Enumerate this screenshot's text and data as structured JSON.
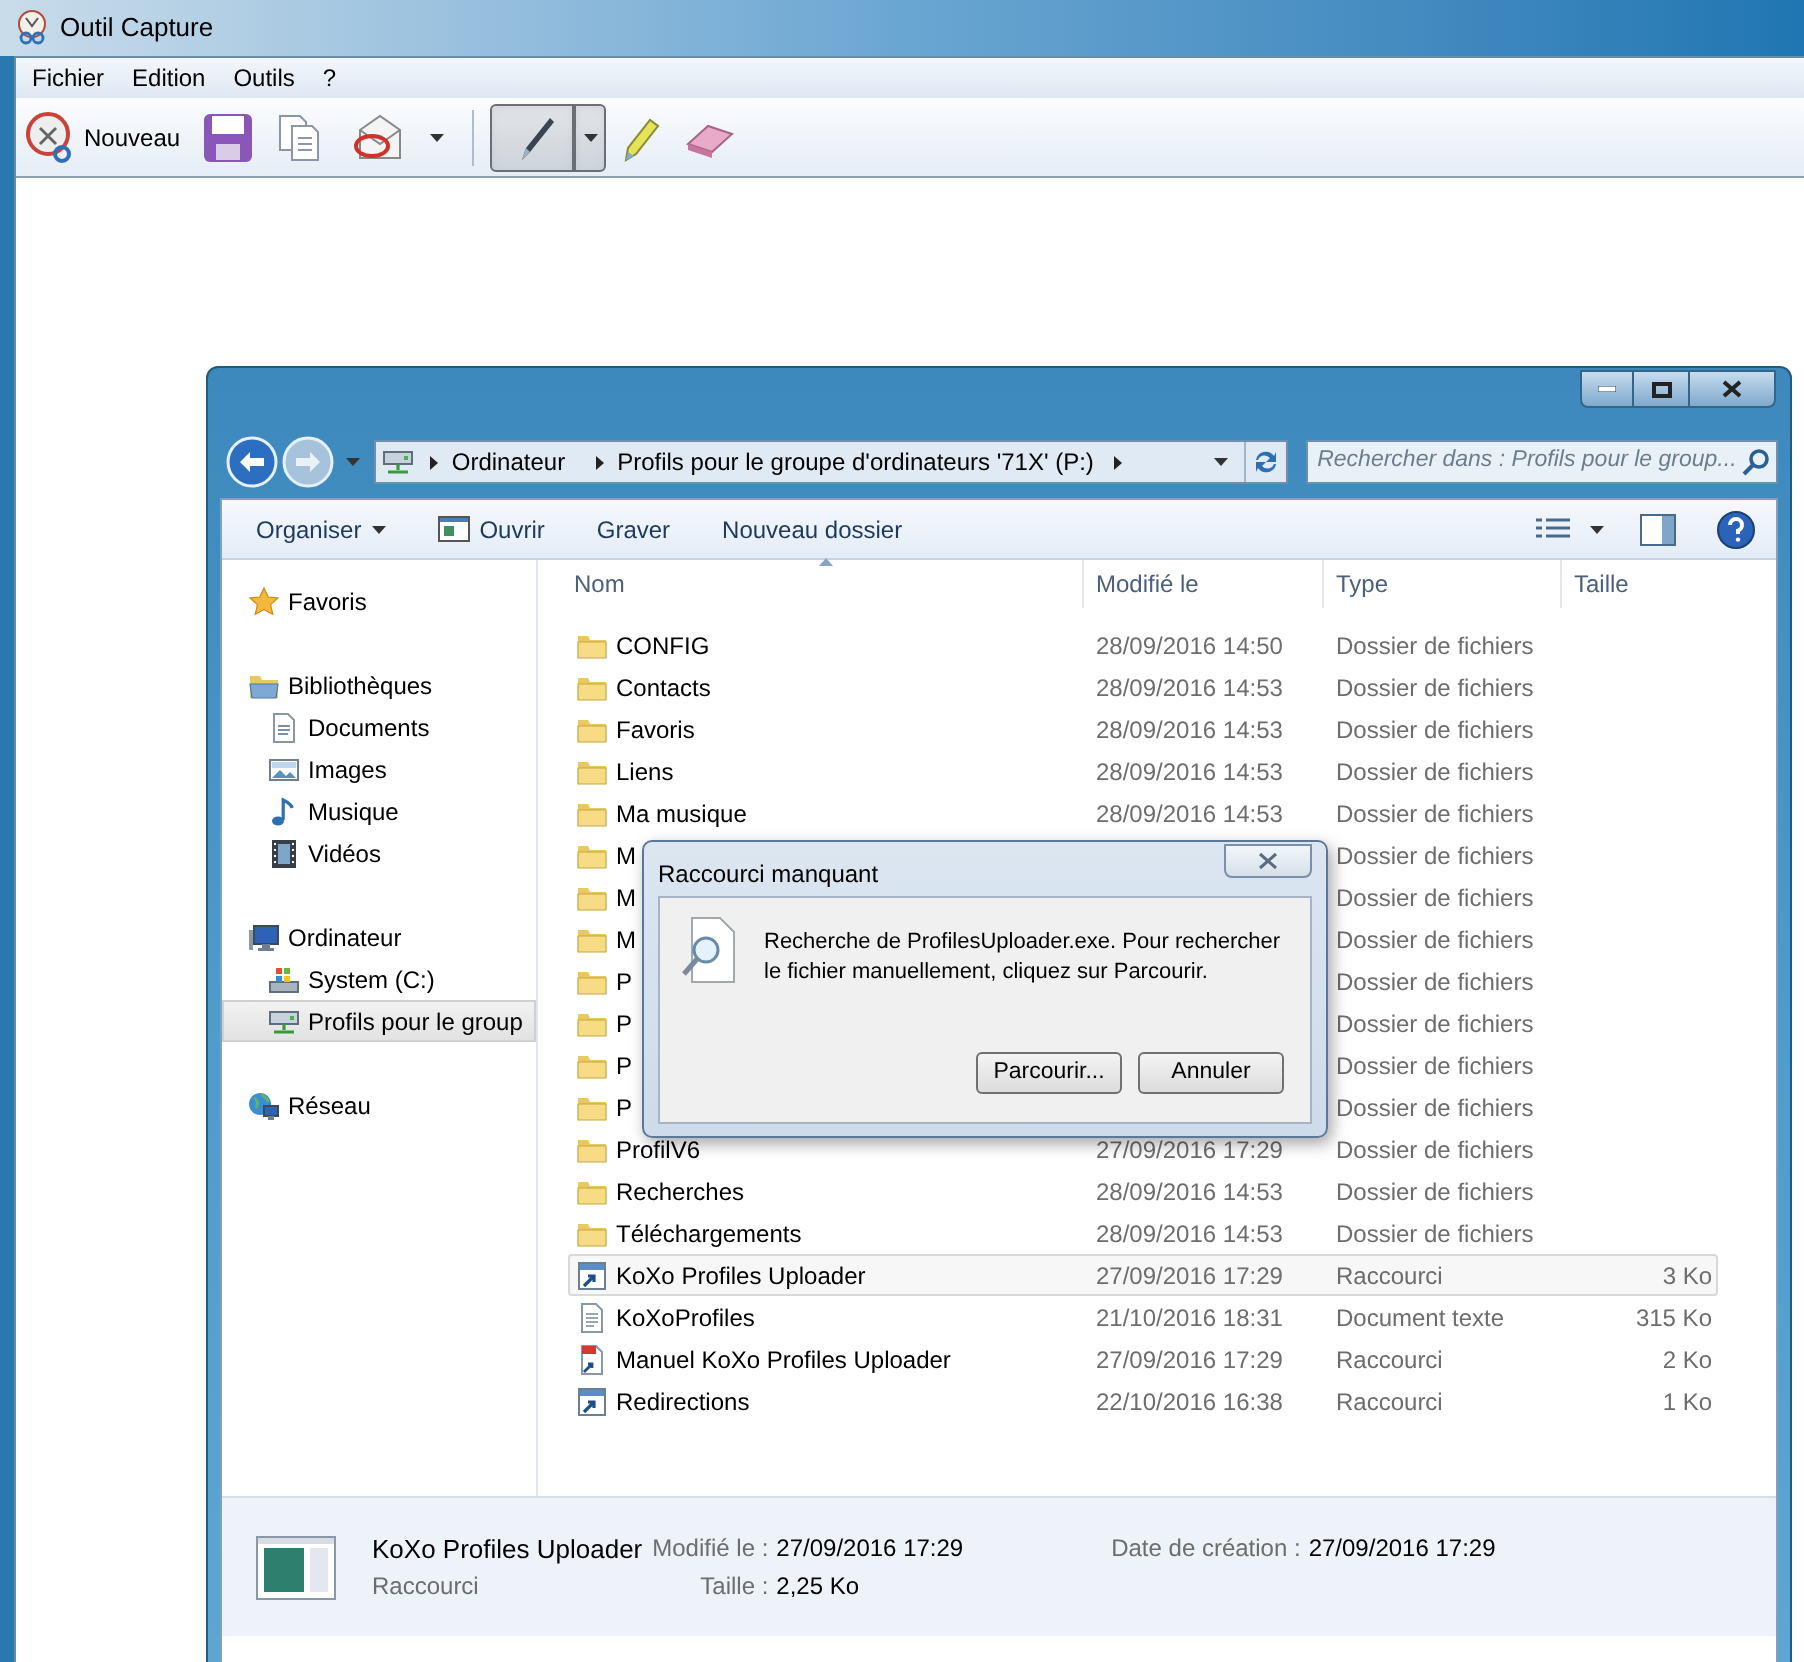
{
  "capture_window": {
    "title": "Outil Capture",
    "menu": [
      "Fichier",
      "Edition",
      "Outils",
      "?"
    ],
    "new_button": {
      "label": "Nouveau"
    },
    "tools": [
      {
        "kind": "pen",
        "selected": true
      },
      {
        "kind": "highlighter",
        "selected": false
      },
      {
        "kind": "eraser",
        "selected": false
      }
    ]
  },
  "explorer": {
    "breadcrumb": [
      "Ordinateur",
      "Profils pour le groupe d'ordinateurs '71X' (P:)"
    ],
    "search": {
      "placeholder": "Rechercher dans : Profils pour le group..."
    },
    "commands": [
      {
        "label": "Organiser",
        "kind": "menu"
      },
      {
        "label": "Ouvrir",
        "kind": "open"
      },
      {
        "label": "Graver",
        "kind": "plain"
      },
      {
        "label": "Nouveau dossier",
        "kind": "plain"
      }
    ],
    "sidebar": [
      {
        "label": "Favoris",
        "kind": "favorites",
        "selected": false
      },
      {
        "label": "Bibliothèques",
        "kind": "libraries",
        "selected": false,
        "children": [
          {
            "label": "Documents",
            "kind": "documents",
            "selected": false
          },
          {
            "label": "Images",
            "kind": "images",
            "selected": false
          },
          {
            "label": "Musique",
            "kind": "music",
            "selected": false
          },
          {
            "label": "Vidéos",
            "kind": "videos",
            "selected": false
          }
        ]
      },
      {
        "label": "Ordinateur",
        "kind": "computer",
        "selected": false,
        "children": [
          {
            "label": "System (C:)",
            "kind": "drive",
            "selected": false
          },
          {
            "label": "Profils pour le group",
            "kind": "network-drive",
            "selected": true
          }
        ]
      },
      {
        "label": "Réseau",
        "kind": "network",
        "selected": false
      }
    ],
    "columns": [
      {
        "label": "Nom",
        "sorted": true
      },
      {
        "label": "Modifié le",
        "sorted": false
      },
      {
        "label": "Type",
        "sorted": false
      },
      {
        "label": "Taille",
        "sorted": false
      }
    ],
    "rows": [
      {
        "name": "CONFIG",
        "modified": "28/09/2016 14:50",
        "type": "Dossier de fichiers",
        "kind": "folder",
        "selected": false
      },
      {
        "name": "Contacts",
        "modified": "28/09/2016 14:53",
        "type": "Dossier de fichiers",
        "kind": "folder",
        "selected": false
      },
      {
        "name": "Favoris",
        "modified": "28/09/2016 14:53",
        "type": "Dossier de fichiers",
        "kind": "folder",
        "selected": false
      },
      {
        "name": "Liens",
        "modified": "28/09/2016 14:53",
        "type": "Dossier de fichiers",
        "kind": "folder",
        "selected": false
      },
      {
        "name": "Ma musique",
        "modified": "28/09/2016 14:53",
        "type": "Dossier de fichiers",
        "kind": "folder",
        "selected": false
      },
      {
        "name": "M",
        "type": "Dossier de fichiers",
        "kind": "folder",
        "selected": false
      },
      {
        "name": "M",
        "type": "Dossier de fichiers",
        "kind": "folder",
        "selected": false
      },
      {
        "name": "M",
        "type": "Dossier de fichiers",
        "kind": "folder",
        "selected": false
      },
      {
        "name": "P",
        "type": "Dossier de fichiers",
        "kind": "folder",
        "selected": false
      },
      {
        "name": "P",
        "type": "Dossier de fichiers",
        "kind": "folder",
        "selected": false
      },
      {
        "name": "P",
        "type": "Dossier de fichiers",
        "kind": "folder",
        "selected": false
      },
      {
        "name": "P",
        "type": "Dossier de fichiers",
        "kind": "folder",
        "selected": false
      },
      {
        "name": "ProfilV6",
        "modified": "27/09/2016 17:29",
        "type": "Dossier de fichiers",
        "kind": "folder",
        "selected": false
      },
      {
        "name": "Recherches",
        "modified": "28/09/2016 14:53",
        "type": "Dossier de fichiers",
        "kind": "folder",
        "selected": false
      },
      {
        "name": "Téléchargements",
        "modified": "28/09/2016 14:53",
        "type": "Dossier de fichiers",
        "kind": "folder",
        "selected": false
      },
      {
        "name": "KoXo Profiles Uploader",
        "modified": "27/09/2016 17:29",
        "type": "Raccourci",
        "size": "3 Ko",
        "kind": "shortcut",
        "selected": true
      },
      {
        "name": "KoXoProfiles",
        "modified": "21/10/2016 18:31",
        "type": "Document texte",
        "size": "315 Ko",
        "kind": "text",
        "selected": false
      },
      {
        "name": "Manuel KoXo Profiles Uploader",
        "modified": "27/09/2016 17:29",
        "type": "Raccourci",
        "size": "2 Ko",
        "kind": "pdf-shortcut",
        "selected": false
      },
      {
        "name": "Redirections",
        "modified": "22/10/2016 16:38",
        "type": "Raccourci",
        "size": "1 Ko",
        "kind": "shortcut",
        "selected": false
      }
    ],
    "details": {
      "name": "KoXo Profiles Uploader",
      "type": "Raccourci",
      "modified_label": "Modifié le :",
      "modified": "27/09/2016 17:29",
      "size_label": "Taille :",
      "size": "2,25 Ko",
      "created_label": "Date de création :",
      "created": "27/09/2016 17:29"
    },
    "dialog": {
      "title": "Raccourci manquant",
      "message": "Recherche de ProfilesUploader.exe. Pour rechercher le fichier manuellement, cliquez sur Parcourir.",
      "buttons": [
        "Parcourir...",
        "Annuler"
      ]
    }
  }
}
